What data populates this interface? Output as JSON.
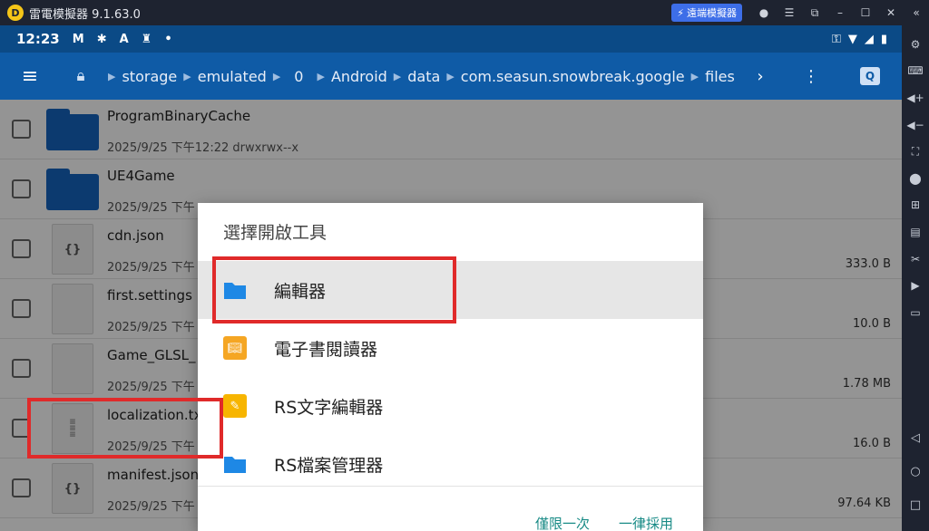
{
  "emulator": {
    "title": "雷電模擬器 9.1.63.0",
    "cloud_label": "遠端模擬器",
    "controls": [
      "user-icon",
      "menu-icon",
      "popout-icon",
      "minimize-icon",
      "maximize-icon",
      "close-icon",
      "collapse-icon"
    ],
    "sidebar_icons": [
      "settings-icon",
      "keyboard-icon",
      "volume-up-icon",
      "volume-down-icon",
      "fullscreen-icon",
      "install-apk-icon",
      "add-instance-icon",
      "macro-icon",
      "screenshot-icon",
      "record-icon",
      "more-icon"
    ],
    "nav": [
      "back-icon",
      "home-icon",
      "recents-icon"
    ]
  },
  "statusbar": {
    "time": "12:23",
    "icons": [
      "M",
      "✱",
      "A",
      "♜",
      "•"
    ],
    "right_icons": [
      "key-icon",
      "wifi-icon",
      "signal-icon",
      "battery-icon"
    ]
  },
  "appbar": {
    "menu_icon": "hamburger-icon",
    "breadcrumb": [
      "storage",
      "emulated",
      "0",
      "Android",
      "data",
      "com.seasun.snowbreak.google",
      "files"
    ]
  },
  "files": [
    {
      "name": "ProgramBinaryCache",
      "meta": "2025/9/25 下午12:22   drwxrwx--x",
      "type": "folder",
      "size": ""
    },
    {
      "name": "UE4Game",
      "meta": "2025/9/25 下午",
      "type": "folder",
      "size": ""
    },
    {
      "name": "cdn.json",
      "meta": "2025/9/25 下午",
      "type": "json",
      "size": "333.0 B"
    },
    {
      "name": "first.settings",
      "meta": "2025/9/25 下午",
      "type": "file",
      "size": "10.0 B"
    },
    {
      "name": "Game_GLSL_",
      "meta": "2025/9/25 下午",
      "type": "file",
      "size": "1.78 MB"
    },
    {
      "name": "localization.tx",
      "meta": "2025/9/25 下午",
      "type": "text",
      "size": "16.0 B"
    },
    {
      "name": "manifest.json",
      "meta": "2025/9/25 下午",
      "type": "json",
      "size": "97.64 KB"
    }
  ],
  "dialog": {
    "title": "選擇開啟工具",
    "options": [
      {
        "label": "編輯器",
        "icon": "folder-icon",
        "color": "#1e88e5"
      },
      {
        "label": "電子書閱讀器",
        "icon": "book-icon",
        "color": "#f5a623"
      },
      {
        "label": "RS文字編輯器",
        "icon": "pencil-icon",
        "color": "#f7b500"
      },
      {
        "label": "RS檔案管理器",
        "icon": "folder-icon",
        "color": "#1e88e5"
      }
    ],
    "once_label": "僅限一次",
    "always_label": "一律採用"
  },
  "colors": {
    "status_bar": "#0b4a86",
    "app_bar": "#0f5ba6",
    "highlight": "#e02a2a",
    "dialog_button": "#178a85"
  }
}
